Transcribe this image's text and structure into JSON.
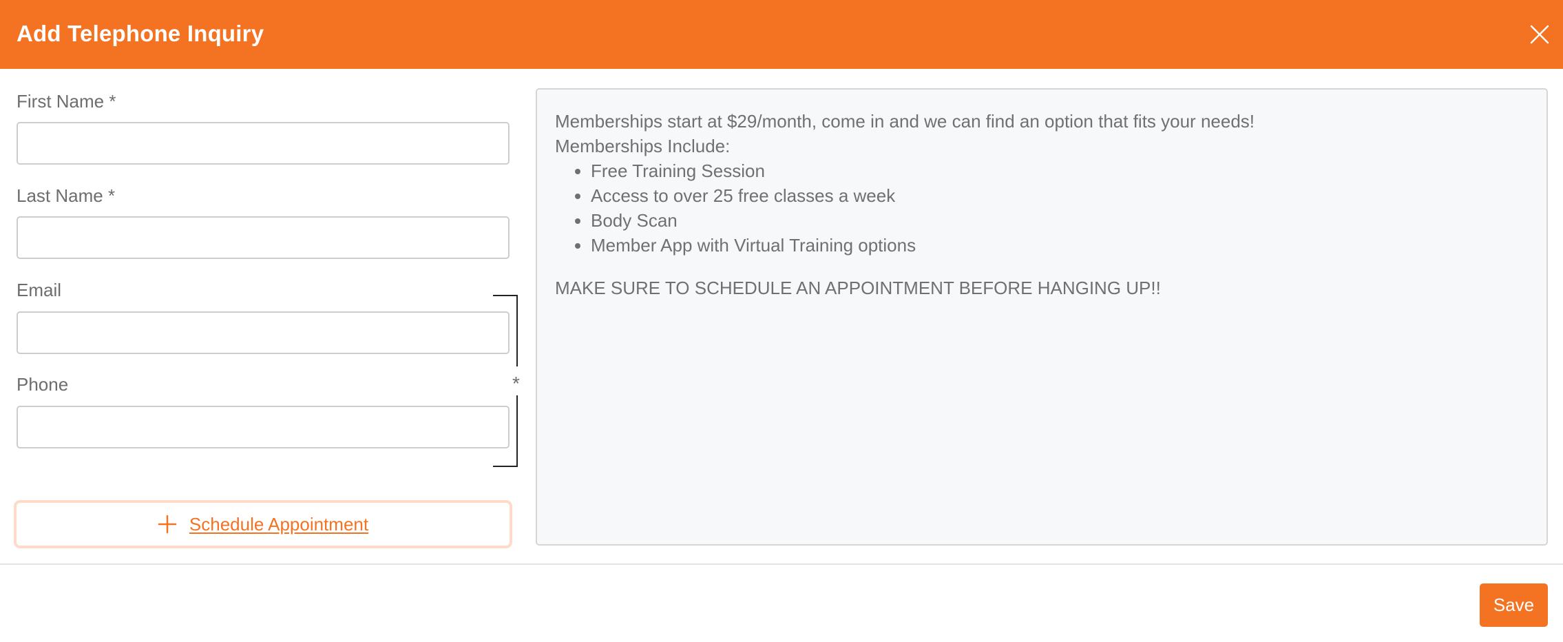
{
  "modal": {
    "title": "Add Telephone Inquiry",
    "close_icon": "close-icon"
  },
  "form": {
    "first_name": {
      "label": "First Name *",
      "value": "",
      "placeholder": ""
    },
    "last_name": {
      "label": "Last Name *",
      "value": "",
      "placeholder": ""
    },
    "email": {
      "label": "Email",
      "value": "",
      "placeholder": ""
    },
    "phone": {
      "label": "Phone",
      "value": "",
      "placeholder": ""
    },
    "contact_required_marker": "*",
    "schedule_button": {
      "label": "Schedule Appointment",
      "icon": "plus-icon"
    }
  },
  "info": {
    "intro": "Memberships start at $29/month, come in and we can find an option that fits your needs!",
    "list_heading": "Memberships Include:",
    "items": [
      "Free Training Session",
      "Access to over 25 free classes a week",
      "Body Scan",
      "Member App with Virtual Training options"
    ],
    "notice": "MAKE SURE TO SCHEDULE AN APPOINTMENT BEFORE HANGING UP!!"
  },
  "footer": {
    "save_label": "Save"
  },
  "colors": {
    "accent": "#f47322",
    "accent_light": "#fcdcc9",
    "panel_bg": "#f7f8fa",
    "label_text": "#6d6d6d"
  }
}
